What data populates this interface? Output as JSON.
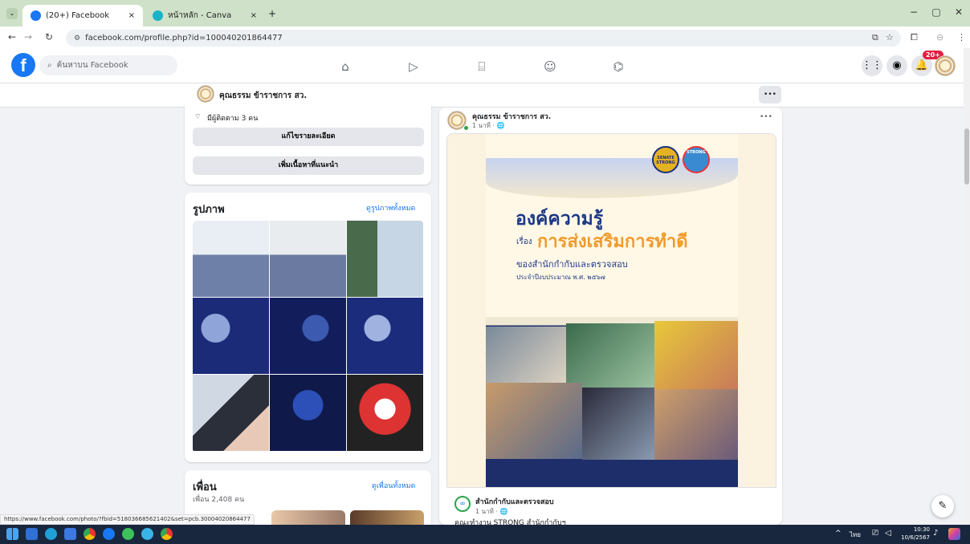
{
  "browser": {
    "tabs": [
      {
        "title": "(20+) Facebook",
        "close": "×"
      },
      {
        "title": "หน้าหลัก - Canva",
        "close": "×"
      }
    ],
    "new_tab": "+",
    "url": "facebook.com/profile.php?id=100040201864477",
    "window": {
      "minimize": "−",
      "restore": "▢",
      "close": "✕"
    }
  },
  "fb": {
    "search_placeholder": "ค้นหาบน Facebook",
    "notif_badge": "20+",
    "profile_name": "คุณธรรม ข้าราชการ สว.",
    "more": "•••"
  },
  "intro": {
    "followers": "มีผู้ติดตาม 3 คน",
    "edit_details": "แก้ไขรายละเอียด",
    "add_featured": "เพิ่มเนื้อหาที่แนะนำ"
  },
  "photos": {
    "title": "รูปภาพ",
    "see_all": "ดูรูปภาพทั้งหมด"
  },
  "friends": {
    "title": "เพื่อน",
    "count": "เพื่อน 2,408 คน",
    "see_all": "ดูเพื่อนทั้งหมด"
  },
  "post": {
    "author": "คุณธรรม ข้าราชการ สว.",
    "time": "1 นาที · 🌐",
    "more": "•••",
    "poster": {
      "heading": "องค์ความรู้",
      "prefix": "เรื่อง",
      "topic": "การส่งเสริมการทำดี",
      "office": "ของสำนักกำกับและตรวจสอบ",
      "year": "ประจำปีงบประมาณ พ.ศ. ๒๕๖๗",
      "badge1": "SENATE STRONG",
      "badge2": "STRONG"
    },
    "shared_author": "สำนักกำกับและตรวจสอบ",
    "shared_time": "1 นาที · 🌐",
    "shared_text": "คณะทำงาน STRONG สำนักกำกับฯ"
  },
  "status_url": "https://www.facebook.com/photo/?fbid=518036685621402&set=pcb.30004020864477",
  "taskbar": {
    "lang": "ไทย",
    "time": "10:30",
    "date": "10/6/2567"
  },
  "colors": {
    "fb_blue": "#1877f2",
    "tab_bar": "#cfe2c9",
    "taskbar": "#18273e"
  }
}
